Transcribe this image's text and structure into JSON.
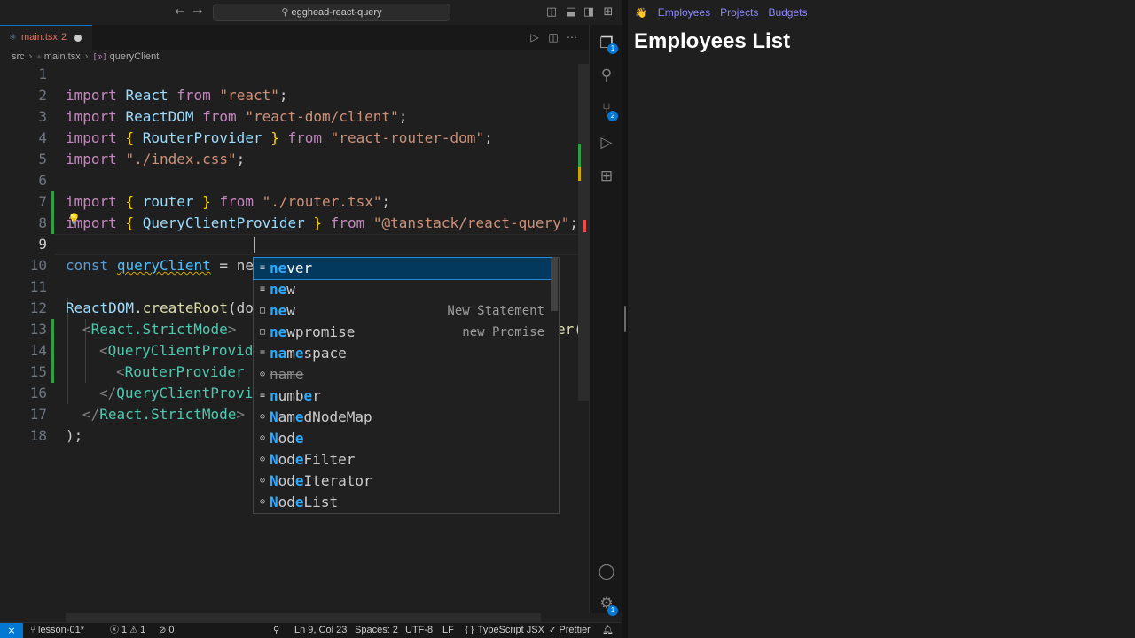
{
  "colors": {
    "accent": "#0078d4",
    "keyword": "#c586c0",
    "string": "#ce9178",
    "identifier": "#9cdcfe",
    "match_highlight": "#2aaaff",
    "nav_link": "#8b84ff"
  },
  "window": {
    "command_center": "egghead-react-query"
  },
  "tab": {
    "filename": "main.tsx",
    "problems": "2"
  },
  "breadcrumb": {
    "folder": "src",
    "file": "main.tsx",
    "symbol": "queryClient"
  },
  "editor": {
    "lines": [
      {
        "n": "1"
      },
      {
        "n": "2"
      },
      {
        "n": "3"
      },
      {
        "n": "4"
      },
      {
        "n": "5"
      },
      {
        "n": "6"
      },
      {
        "n": "7"
      },
      {
        "n": "8"
      },
      {
        "n": "9"
      },
      {
        "n": "10"
      },
      {
        "n": "11"
      },
      {
        "n": "12"
      },
      {
        "n": "13"
      },
      {
        "n": "14"
      },
      {
        "n": "15"
      },
      {
        "n": "16"
      },
      {
        "n": "17"
      },
      {
        "n": "18"
      }
    ],
    "code": {
      "l1": {
        "kw": "import",
        "id": "React",
        "from": "from",
        "str": "\"react\"",
        "end": ";"
      },
      "l2": {
        "kw": "import",
        "id": "ReactDOM",
        "from": "from",
        "str": "\"react-dom/client\"",
        "end": ";"
      },
      "l3": {
        "kw": "import",
        "open": "{",
        "id": "RouterProvider",
        "close": "}",
        "from": "from",
        "str": "\"react-router-dom\"",
        "end": ";"
      },
      "l4": {
        "kw": "import",
        "str": "\"./index.css\"",
        "end": ";"
      },
      "l6": {
        "kw": "import",
        "open": "{",
        "id": "router",
        "close": "}",
        "from": "from",
        "str": "\"./router.tsx\"",
        "end": ";"
      },
      "l7": {
        "kw": "import",
        "open": "{",
        "id": "QueryClientProvider",
        "close": "}",
        "from": "from",
        "str": "\"@tanstack/react-query\"",
        "end": ";"
      },
      "l9": {
        "kw": "const",
        "id": "queryClient",
        "eq": "=",
        "typed": "ne"
      },
      "l11": {
        "obj": "ReactDOM",
        "dot": ".",
        "fn": "createRoot",
        "paren": "(do",
        "tail": "er("
      },
      "l12": {
        "lt": "<",
        "tag": "React.StrictMode",
        "gt": ">"
      },
      "l13": {
        "lt": "<",
        "tag": "QueryClientProvid"
      },
      "l14": {
        "lt": "<",
        "tag": "RouterProvider"
      },
      "l15": {
        "lt": "</",
        "tag": "QueryClientProvi"
      },
      "l16": {
        "lt": "</",
        "tag": "React.StrictMode",
        "gt": ">"
      },
      "l17": {
        "text": ");"
      }
    }
  },
  "suggestions": [
    {
      "hl": "ne",
      "rest": "ver",
      "detail": "",
      "icon": "keyword-icon",
      "selected": true
    },
    {
      "hl": "ne",
      "rest": "w",
      "detail": "",
      "icon": "keyword-icon"
    },
    {
      "hl": "ne",
      "rest": "w",
      "detail": "New Statement",
      "icon": "snippet-icon"
    },
    {
      "hl": "ne",
      "rest": "wpromise",
      "detail": "new Promise",
      "icon": "snippet-icon"
    },
    {
      "hl": "na",
      "mid": "m",
      "hl2": "e",
      "rest": "space",
      "detail": "",
      "icon": "keyword-icon"
    },
    {
      "plain": "name",
      "detail": "",
      "icon": "variable-icon",
      "deprecated": true
    },
    {
      "hl": "n",
      "mid": "umb",
      "hl2": "e",
      "rest": "r",
      "detail": "",
      "icon": "keyword-icon"
    },
    {
      "hl": "N",
      "mid": "am",
      "hl2": "e",
      "rest": "dNodeMap",
      "detail": "",
      "icon": "variable-icon"
    },
    {
      "hl": "N",
      "mid": "od",
      "hl2": "e",
      "rest": "",
      "detail": "",
      "icon": "variable-icon"
    },
    {
      "hl": "N",
      "mid": "od",
      "hl2": "e",
      "rest": "Filter",
      "detail": "",
      "icon": "variable-icon"
    },
    {
      "hl": "N",
      "mid": "od",
      "hl2": "e",
      "rest": "Iterator",
      "detail": "",
      "icon": "variable-icon"
    },
    {
      "hl": "N",
      "mid": "od",
      "hl2": "e",
      "rest": "List",
      "detail": "",
      "icon": "variable-icon"
    }
  ],
  "activity": {
    "explorer_badge": "1",
    "scm_badge": "2",
    "settings_badge": "1"
  },
  "status": {
    "branch": "lesson-01*",
    "errors": "1",
    "warnings": "1",
    "ports": "0",
    "position": "Ln 9, Col 23",
    "spaces": "Spaces: 2",
    "encoding": "UTF-8",
    "eol": "LF",
    "language": "TypeScript JSX",
    "formatter": "Prettier"
  },
  "page": {
    "nav": [
      "Employees",
      "Projects",
      "Budgets"
    ],
    "title": "Employees List"
  }
}
